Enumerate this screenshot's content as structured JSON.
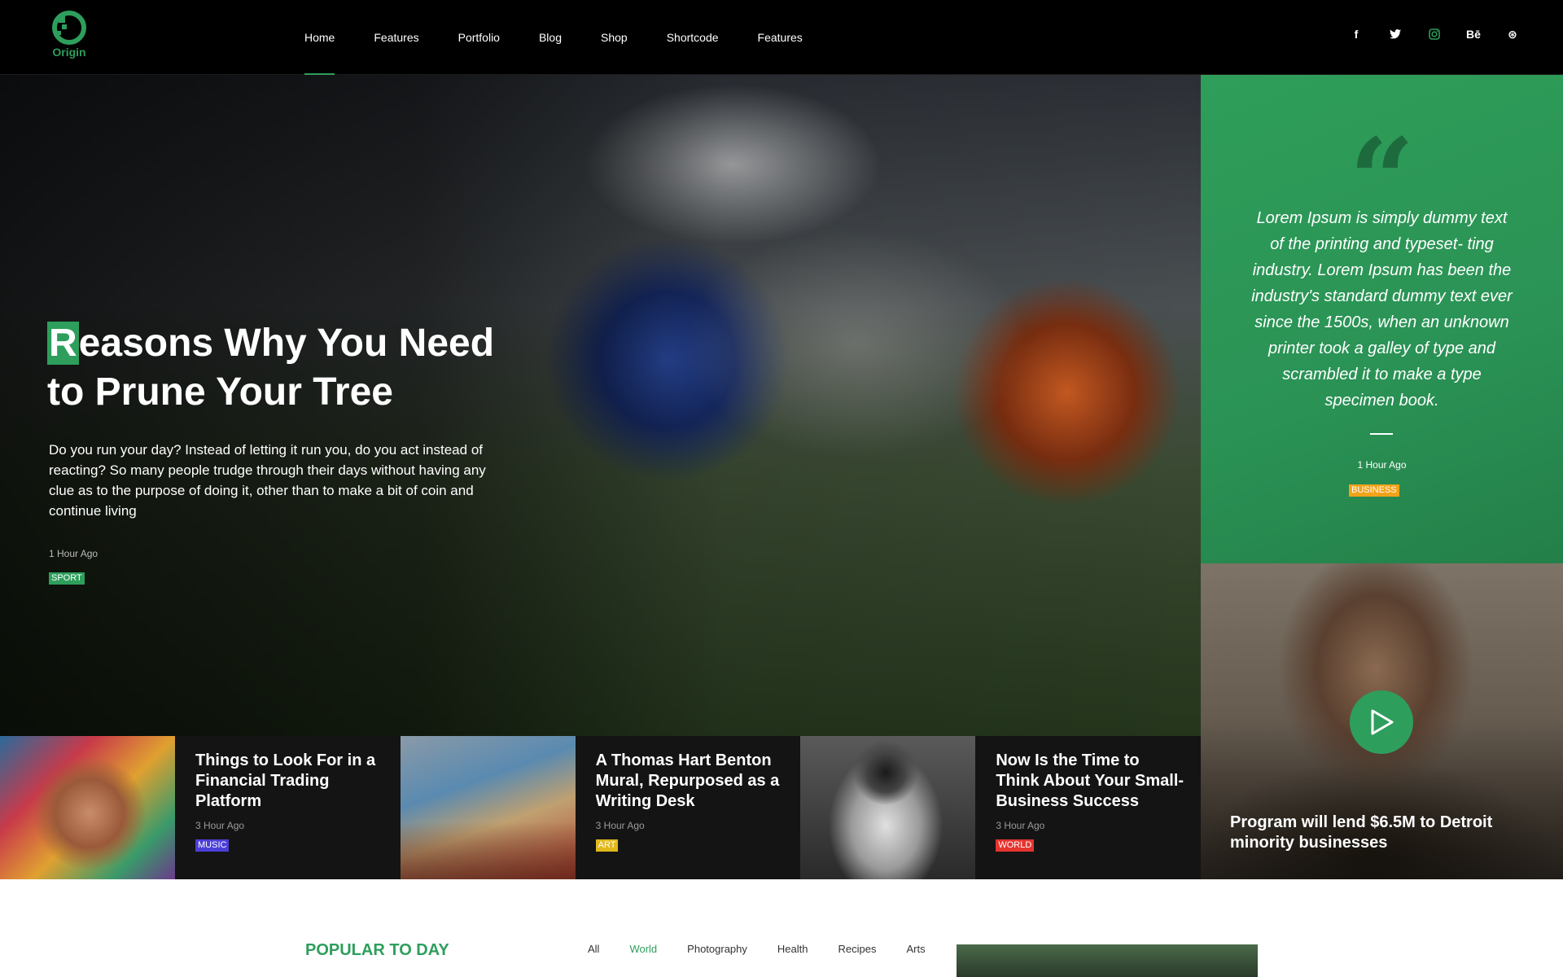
{
  "brand": {
    "name": "Origin",
    "color": "#2e9e5c"
  },
  "nav": {
    "items": [
      {
        "label": "Home",
        "active": true
      },
      {
        "label": "Features",
        "active": false
      },
      {
        "label": "Portfolio",
        "active": false
      },
      {
        "label": "Blog",
        "active": false
      },
      {
        "label": "Shop",
        "active": false
      },
      {
        "label": "Shortcode",
        "active": false
      },
      {
        "label": "Features",
        "active": false
      }
    ]
  },
  "socials": [
    {
      "icon": "facebook-icon",
      "glyph": "f"
    },
    {
      "icon": "twitter-icon",
      "glyph": "t"
    },
    {
      "icon": "instagram-icon",
      "glyph": "ig"
    },
    {
      "icon": "behance-icon",
      "glyph": "Bē"
    },
    {
      "icon": "dribbble-icon",
      "glyph": "⊛"
    }
  ],
  "hero": {
    "title_first": "R",
    "title_rest_line1": "easons Why You Need",
    "title_line2": "to Prune Your Tree",
    "excerpt": "Do you run your day? Instead of letting it run you, do you act instead of reacting? So many people trudge through their days without having any clue as to the purpose of doing it, other than to make a bit of coin and continue living",
    "time": "1 Hour Ago",
    "category": "SPORT",
    "category_color": "#2e9e5c"
  },
  "quote": {
    "mark": "“",
    "text": "Lorem Ipsum is simply dummy text of the printing and typeset- ting industry. Lorem Ipsum has been the industry's standard dummy text ever since the 1500s, when an unknown printer took a galley of type and scrambled it to make a type specimen book.",
    "time": "1 Hour Ago",
    "category": "BUSINESS",
    "category_color": "#f2a31a"
  },
  "video": {
    "title": "Program will lend $6.5M to Detroit minority businesses",
    "play_icon": "play-icon"
  },
  "strip": [
    {
      "title": "Things to Look For in a Financial Trading Platform",
      "time": "3 Hour Ago",
      "category": "MUSIC",
      "category_color": "#4b3fd6"
    },
    {
      "title": "A Thomas Hart Benton Mural, Repurposed as a Writing Desk",
      "time": "3 Hour Ago",
      "category": "ART",
      "category_color": "#e0b81c"
    },
    {
      "title": "Now Is the Time to Think About Your Small-Business Success",
      "time": "3 Hour Ago",
      "category": "WORLD",
      "category_color": "#e5342f"
    }
  ],
  "popular": {
    "title": "POPULAR TO DAY",
    "filters": [
      {
        "label": "All",
        "active": false
      },
      {
        "label": "World",
        "active": true
      },
      {
        "label": "Photography",
        "active": false
      },
      {
        "label": "Health",
        "active": false
      },
      {
        "label": "Recipes",
        "active": false
      },
      {
        "label": "Arts",
        "active": false
      }
    ]
  }
}
